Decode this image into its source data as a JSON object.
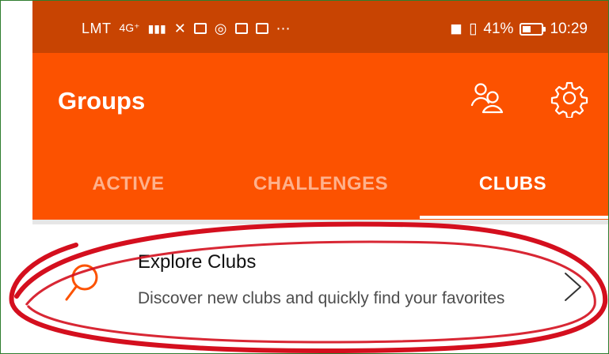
{
  "status_bar": {
    "carrier": "LMT",
    "signal_label": "4G⁺",
    "status_right_text": "41%",
    "time": "10:29"
  },
  "app_bar": {
    "title": "Groups",
    "people_icon": "people-icon",
    "settings_icon": "gear-icon"
  },
  "tabs": [
    {
      "label": "ACTIVE",
      "selected": false
    },
    {
      "label": "CHALLENGES",
      "selected": false
    },
    {
      "label": "CLUBS",
      "selected": true
    }
  ],
  "list": {
    "items": [
      {
        "title": "Explore Clubs",
        "description": "Discover new clubs and quickly find your favorites",
        "icon": "search-icon",
        "trailing_icon": "chevron-right-icon"
      }
    ]
  },
  "colors": {
    "status_bar": "#c84402",
    "app_bar": "#fc5200",
    "accent": "#fc5200",
    "annotation": "#d40f1e"
  }
}
